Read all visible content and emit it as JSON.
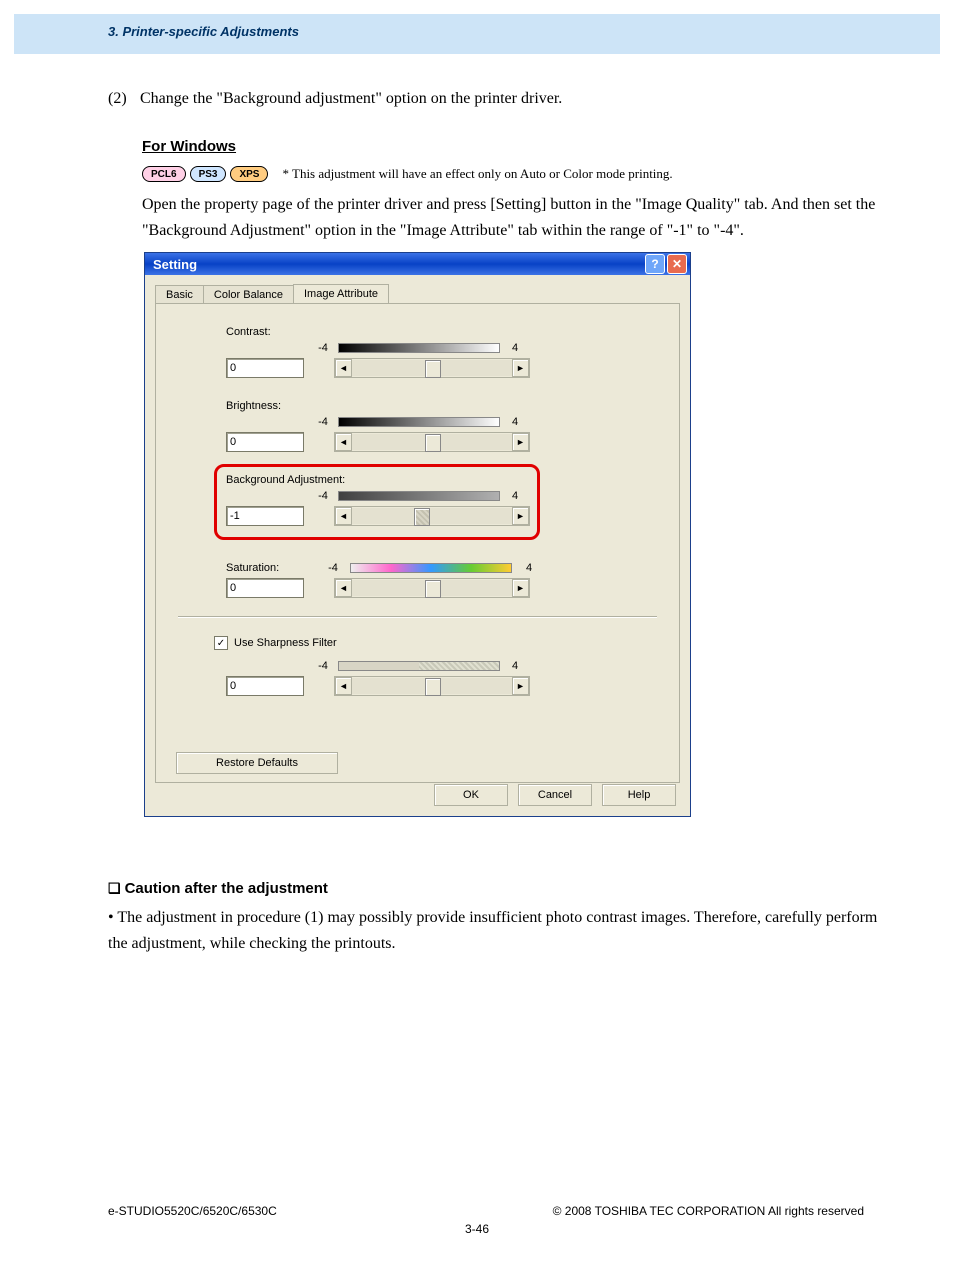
{
  "header": {
    "section_title": "3. Printer-specific Adjustments"
  },
  "step": {
    "number": "(2)",
    "text": "Change the \"Background adjustment\" option on the printer driver."
  },
  "for_windows": "For Windows",
  "badges": {
    "pcl6": "PCL6",
    "ps3": "PS3",
    "xps": "XPS"
  },
  "badge_note": "* This adjustment will have an effect only on Auto or Color mode printing.",
  "paragraph": "Open the property page of the printer driver and press [Setting] button in the \"Image Quality\" tab. And then set the \"Background Adjustment\" option in the \"Image Attribute\" tab within the range of \"-1\" to \"-4\".",
  "dialog": {
    "title": "Setting",
    "help_btn": "?",
    "close_btn": "✕",
    "tabs": {
      "basic": "Basic",
      "color_balance": "Color Balance",
      "image_attribute": "Image Attribute"
    },
    "labels": {
      "contrast": "Contrast:",
      "brightness": "Brightness:",
      "background": "Background Adjustment:",
      "saturation": "Saturation:",
      "sharpness_cb": "Use Sharpness Filter"
    },
    "scale": {
      "min": "-4",
      "max": "4"
    },
    "values": {
      "contrast": "0",
      "brightness": "0",
      "background": "-1",
      "saturation": "0",
      "sharpness": "0"
    },
    "arrows": {
      "left": "◄",
      "right": "►"
    },
    "restore": "Restore Defaults",
    "buttons": {
      "ok": "OK",
      "cancel": "Cancel",
      "help": "Help"
    }
  },
  "caution": {
    "heading": "Caution after the adjustment",
    "bullet": "• The adjustment in procedure (1) may possibly provide insufficient photo contrast images.  Therefore, carefully perform the adjustment, while checking the printouts."
  },
  "footer": {
    "left": "e-STUDIO5520C/6520C/6530C",
    "right": "© 2008 TOSHIBA TEC CORPORATION All rights reserved",
    "page": "3-46"
  }
}
